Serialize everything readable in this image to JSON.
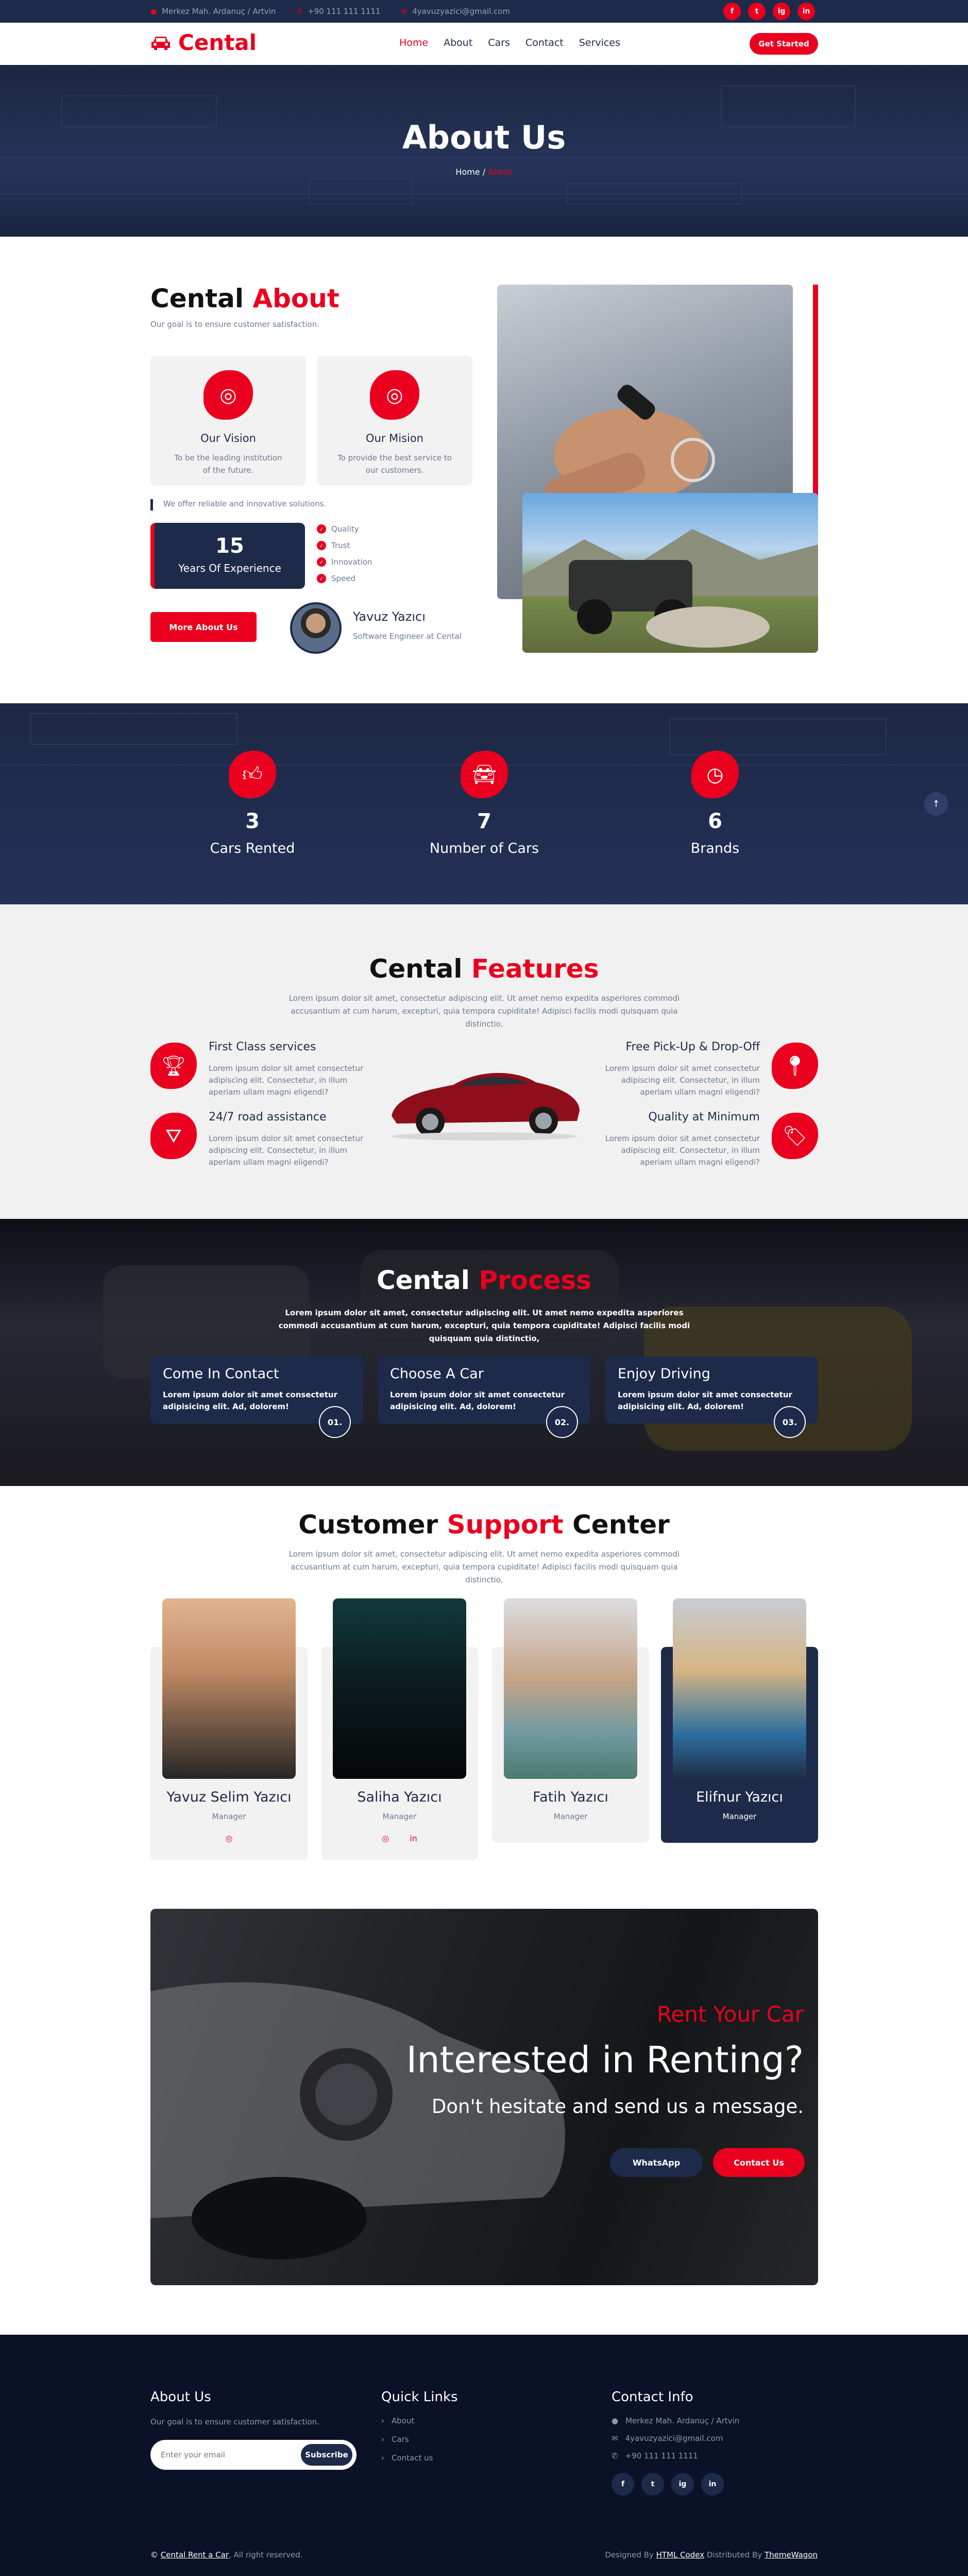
{
  "topbar": {
    "address": "Merkez Mah. Ardanuç / Artvin",
    "phone": "+90 111 111 1111",
    "email": "4yavuzyazici@gmail.com",
    "social": [
      "f",
      "t",
      "ig",
      "in"
    ]
  },
  "nav": {
    "brand": "Cental",
    "items": [
      "Home",
      "About",
      "Cars",
      "Contact",
      "Services"
    ],
    "active": "Home",
    "cta": "Get Started"
  },
  "hero": {
    "title": "About Us",
    "breadcrumb_home": "Home",
    "breadcrumb_current": "About"
  },
  "about": {
    "title_a": "Cental ",
    "title_b": "About",
    "subtitle": "Our goal is to ensure customer satisfaction.",
    "vision_title": "Our Vision",
    "vision_text": "To be the leading institution of the future.",
    "mission_title": "Our Mision",
    "mission_text": "To provide the best service to our customers.",
    "note": "We offer reliable and innovative solutions.",
    "exp_number": "15",
    "exp_label": "Years Of Experience",
    "checks": [
      "Quality",
      "Trust",
      "Innovation",
      "Speed"
    ],
    "button": "More About Us",
    "person_name": "Yavuz Yazıcı",
    "person_role": "Software Engineer at Cental"
  },
  "counters": [
    {
      "icon": "thumbs-up-icon",
      "number": "3",
      "label": "Cars Rented"
    },
    {
      "icon": "car-icon",
      "number": "7",
      "label": "Number of Cars"
    },
    {
      "icon": "clock-icon",
      "number": "6",
      "label": "Brands"
    }
  ],
  "features": {
    "title_a": "Cental ",
    "title_b": "Features",
    "intro": "Lorem ipsum dolor sit amet, consectetur adipiscing elit. Ut amet nemo expedita asperiores commodi accusantium at cum harum, excepturi, quia tempora cupiditate! Adipisci facilis modi quisquam quia distinctio,",
    "items": [
      {
        "title": "First Class services",
        "text": "Lorem ipsum dolor sit amet consectetur adipiscing elit. Consectetur, in illum aperiam ullam magni eligendi?"
      },
      {
        "title": "24/7 road assistance",
        "text": "Lorem ipsum dolor sit amet consectetur adipiscing elit. Consectetur, in illum aperiam ullam magni eligendi?"
      },
      {
        "title": "Free Pick-Up & Drop-Off",
        "text": "Lorem ipsum dolor sit amet consectetur adipiscing elit. Consectetur, in illum aperiam ullam magni eligendi?"
      },
      {
        "title": "Quality at Minimum",
        "text": "Lorem ipsum dolor sit amet consectetur adipiscing elit. Consectetur, in illum aperiam ullam magni eligendi?"
      }
    ]
  },
  "process": {
    "title_a": "Cental ",
    "title_b": "Process",
    "intro": "Lorem ipsum dolor sit amet, consectetur adipiscing elit. Ut amet nemo expedita asperiores commodi accusantium at cum harum, excepturi, quia tempora cupiditate! Adipisci facilis modi quisquam quia distinctio,",
    "steps": [
      {
        "title": "Come In Contact",
        "text": "Lorem ipsum dolor sit amet consectetur adipisicing elit. Ad, dolorem!",
        "num": "01."
      },
      {
        "title": "Choose A Car",
        "text": "Lorem ipsum dolor sit amet consectetur adipisicing elit. Ad, dolorem!",
        "num": "02."
      },
      {
        "title": "Enjoy Driving",
        "text": "Lorem ipsum dolor sit amet consectetur adipisicing elit. Ad, dolorem!",
        "num": "03."
      }
    ]
  },
  "support": {
    "title_a": "Customer ",
    "title_b": "Support",
    "title_c": " Center",
    "intro": "Lorem ipsum dolor sit amet, consectetur adipiscing elit. Ut amet nemo expedita asperiores commodi accusantium at cum harum, excepturi, quia tempora cupiditate! Adipisci facilis modi quisquam quia distinctio,",
    "members": [
      {
        "name": "Yavuz Selim Yazıcı",
        "role": "Manager"
      },
      {
        "name": "Saliha Yazıcı",
        "role": "Manager"
      },
      {
        "name": "Fatih Yazıcı",
        "role": "Manager"
      },
      {
        "name": "Elifnur Yazıcı",
        "role": "Manager"
      }
    ]
  },
  "banner": {
    "kicker": "Rent Your Car",
    "title": "Interested in Renting?",
    "subtitle": "Don't hesitate and send us a message.",
    "btn_whatsapp": "WhatsApp",
    "btn_contact": "Contact Us"
  },
  "footer": {
    "about_title": "About Us",
    "about_text": "Our goal is to ensure customer satisfaction.",
    "email_placeholder": "Enter your email",
    "subscribe": "Subscribe",
    "links_title": "Quick Links",
    "links": [
      "About",
      "Cars",
      "Contact us"
    ],
    "contact_title": "Contact Info",
    "address": "Merkez Mah. Ardanuç / Artvin",
    "email": "4yavuzyazici@gmail.com",
    "phone": "+90 111 111 1111",
    "social": [
      "f",
      "t",
      "ig",
      "in"
    ],
    "copyright_brand": "Cental Rent a Car",
    "copyright_text": ", All right reserved.",
    "designed_by_label": "Designed By ",
    "designed_by": "HTML Codex",
    "distributed_label": " Distributed By ",
    "distributed_by": "ThemeWagon"
  },
  "colors": {
    "accent": "#ea001e",
    "navy": "#1e2a4a",
    "footer": "#0b1227"
  }
}
